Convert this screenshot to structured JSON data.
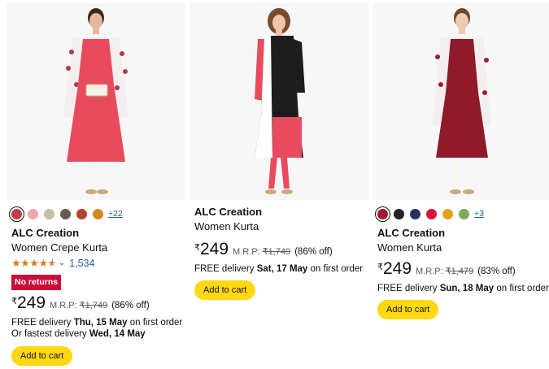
{
  "colors": {
    "accent_link": "#2162a1",
    "star": "#de7921",
    "badge_bg": "#cc0c39",
    "button_bg": "#ffd814",
    "image_bg": "#f7f7f7"
  },
  "products": [
    {
      "image_alt": "Woman in red kurta with floral jacket",
      "swatches": [
        "#c0404a",
        "#f2a6b2",
        "#c8bca6",
        "#6a5a55",
        "#b2452c",
        "#d28a1a"
      ],
      "swatch_more": "+22",
      "brand": "ALC Creation",
      "title": "Women Crepe Kurta",
      "rating": 4.0,
      "rating_count": "1,534",
      "badge": "No returns",
      "currency": "₹",
      "price": "249",
      "mrp_label": "M.R.P:",
      "mrp": "₹1,749",
      "discount": "(86% off)",
      "delivery_prefix": "FREE delivery ",
      "delivery_date": "Thu, 15 May",
      "delivery_suffix": " on first order",
      "fastest_prefix": "Or fastest delivery ",
      "fastest_date": "Wed, 14 May",
      "button": "Add to cart"
    },
    {
      "image_alt": "Woman in black white and red kurta",
      "brand": "ALC Creation",
      "title": "Women Kurta",
      "currency": "₹",
      "price": "249",
      "mrp_label": "M.R.P:",
      "mrp": "₹1,749",
      "discount": "(86% off)",
      "delivery_prefix": "FREE delivery ",
      "delivery_date": "Sat, 17 May",
      "delivery_suffix": " on first order",
      "button": "Add to cart"
    },
    {
      "image_alt": "Woman in maroon kurta with printed jacket",
      "swatches": [
        "#a01c32",
        "#222222",
        "#26305e",
        "#d6163e",
        "#e3a21a",
        "#7ea85a"
      ],
      "swatch_more": "+3",
      "brand": "ALC Creation",
      "title": "Women Kurta",
      "currency": "₹",
      "price": "249",
      "mrp_label": "M.R.P:",
      "mrp": "₹1,479",
      "discount": "(83% off)",
      "delivery_prefix": "FREE delivery ",
      "delivery_date": "Sun, 18 May",
      "delivery_suffix": " on first order",
      "button": "Add to cart"
    }
  ]
}
